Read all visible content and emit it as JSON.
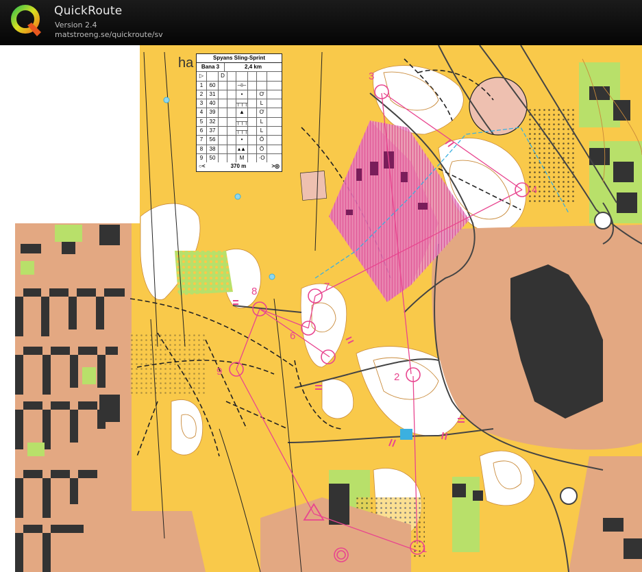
{
  "app": {
    "title": "QuickRoute",
    "version": "Version 2.4",
    "url": "matstroeng.se/quickroute/sv",
    "logo_icon": "quickroute-q-logo"
  },
  "control_description": {
    "event": "Spyans Sling-Sprint",
    "course": "Bana 3",
    "length": "2,4 km",
    "controls": [
      {
        "num": "1",
        "code": "60",
        "symbol": "fence-crossing"
      },
      {
        "num": "2",
        "code": "31",
        "symbol": "dot"
      },
      {
        "num": "3",
        "code": "40",
        "symbol": "wall"
      },
      {
        "num": "4",
        "code": "39",
        "symbol": "triangle"
      },
      {
        "num": "5",
        "code": "32",
        "symbol": "wall"
      },
      {
        "num": "6",
        "code": "37",
        "symbol": "wall"
      },
      {
        "num": "7",
        "code": "56",
        "symbol": "dot"
      },
      {
        "num": "8",
        "code": "38",
        "symbol": "boulders"
      },
      {
        "num": "9",
        "code": "50",
        "symbol": "rootstock"
      }
    ],
    "finish": "370 m"
  },
  "map": {
    "control_labels": [
      "1",
      "2",
      "3",
      "4",
      "6",
      "7",
      "8",
      "9"
    ],
    "colors": {
      "open_yellow": "#f9c94a",
      "forest_white": "#ffffff",
      "green": "#b8e06a",
      "paved_brown": "#e3a882",
      "building": "#333333",
      "course_magenta": "#e8458f",
      "forbidden_pink": "#e45aa8"
    }
  }
}
